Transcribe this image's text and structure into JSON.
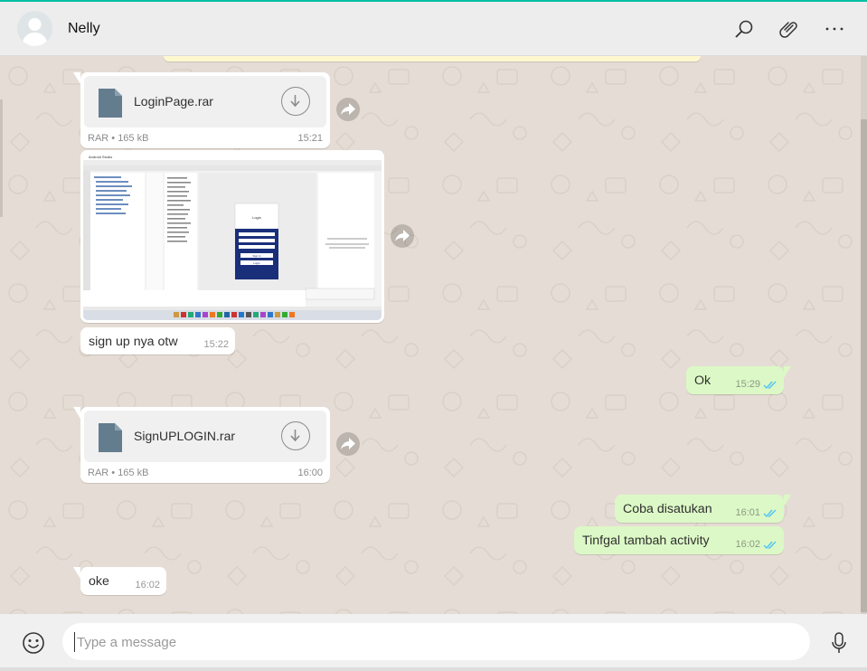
{
  "header": {
    "contact_name": "Nelly",
    "icons": [
      "search-icon",
      "attach-icon",
      "more-icon"
    ]
  },
  "messages": [
    {
      "type": "file",
      "direction": "in",
      "file_name": "LoginPage.rar",
      "file_meta": "RAR • 165 kB",
      "time": "15:21"
    },
    {
      "type": "image",
      "direction": "in",
      "description_icon": "screenshot-image",
      "image_text": {
        "window_title": "Android Studio",
        "login_title": "Login",
        "signup_label": "Sign In",
        "login_label": "Login"
      }
    },
    {
      "type": "text",
      "direction": "in",
      "text": "sign up nya otw",
      "time": "15:22"
    },
    {
      "type": "text",
      "direction": "out",
      "text": "Ok",
      "time": "15:29",
      "status": "read"
    },
    {
      "type": "file",
      "direction": "in",
      "file_name": "SignUPLOGIN.rar",
      "file_meta": "RAR • 165 kB",
      "time": "16:00"
    },
    {
      "type": "text",
      "direction": "out",
      "text": "Coba disatukan",
      "time": "16:01",
      "status": "read"
    },
    {
      "type": "text",
      "direction": "out",
      "text": "Tinfgal tambah activity",
      "time": "16:02",
      "status": "read"
    },
    {
      "type": "text",
      "direction": "in",
      "text": "oke",
      "time": "16:02"
    }
  ],
  "composer": {
    "placeholder": "Type a message",
    "value": "",
    "icons": [
      "emoji-icon",
      "mic-icon"
    ]
  },
  "colors": {
    "accent": "#00bfa5",
    "chat_background": "#e5ddd5",
    "outgoing_bubble": "#dcf8c6",
    "incoming_bubble": "#ffffff",
    "read_ticks": "#4fc3f7"
  }
}
